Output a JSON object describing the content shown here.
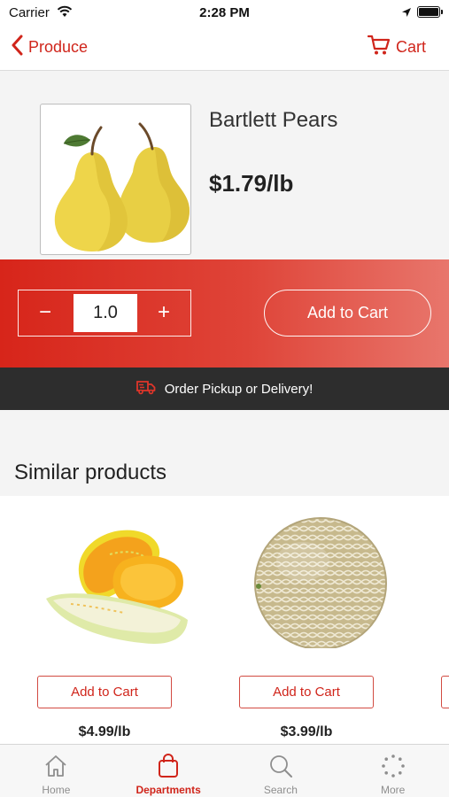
{
  "status_bar": {
    "carrier": "Carrier",
    "time": "2:28 PM"
  },
  "nav": {
    "back_label": "Produce",
    "cart_label": "Cart"
  },
  "product": {
    "name": "Bartlett Pears",
    "price": "$1.79/lb",
    "image_icon": "pears-image"
  },
  "quantity": {
    "value": "1.0",
    "minus": "−",
    "plus": "+"
  },
  "add_to_cart_label": "Add to Cart",
  "promo": {
    "text": "Order Pickup or Delivery!",
    "icon": "delivery-truck-icon"
  },
  "similar": {
    "title": "Similar products",
    "items": [
      {
        "image": "honeydew-melon-image",
        "button": "Add to Cart",
        "price": "$4.99/lb"
      },
      {
        "image": "cantaloupe-image",
        "button": "Add to Cart",
        "price": "$3.99/lb"
      }
    ]
  },
  "tabs": [
    {
      "label": "Home",
      "icon": "home-icon",
      "active": false
    },
    {
      "label": "Departments",
      "icon": "shopping-bag-icon",
      "active": true
    },
    {
      "label": "Search",
      "icon": "search-icon",
      "active": false
    },
    {
      "label": "More",
      "icon": "more-icon",
      "active": false
    }
  ],
  "colors": {
    "accent": "#d0251b",
    "promo_bg": "#2d2d2d",
    "band_start": "#d7251a",
    "band_end": "#e8766c"
  }
}
